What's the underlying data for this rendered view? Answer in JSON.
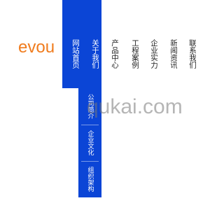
{
  "logo": {
    "text": "evou"
  },
  "nav": {
    "items": [
      {
        "label": "网站首页"
      },
      {
        "label": "关于我们"
      },
      {
        "label": "产品中心"
      },
      {
        "label": "工程案例"
      },
      {
        "label": "企业实力"
      },
      {
        "label": "新闻资讯"
      },
      {
        "label": "联系我们"
      }
    ],
    "dropdown": [
      {
        "label": "公司简介"
      },
      {
        "label": "企业文化"
      },
      {
        "label": "组织架构"
      }
    ]
  },
  "watermark": {
    "text": "qukai.com"
  },
  "colors": {
    "brand_orange": "#f07c1e",
    "nav_blue": "#0b45d6"
  }
}
